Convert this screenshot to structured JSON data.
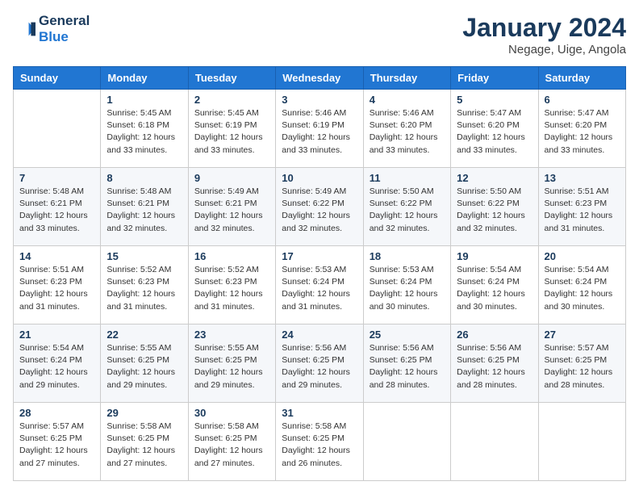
{
  "logo": {
    "line1": "General",
    "line2": "Blue"
  },
  "title": "January 2024",
  "subtitle": "Negage, Uige, Angola",
  "weekdays": [
    "Sunday",
    "Monday",
    "Tuesday",
    "Wednesday",
    "Thursday",
    "Friday",
    "Saturday"
  ],
  "weeks": [
    [
      {
        "day": "",
        "info": ""
      },
      {
        "day": "1",
        "info": "Sunrise: 5:45 AM\nSunset: 6:18 PM\nDaylight: 12 hours\nand 33 minutes."
      },
      {
        "day": "2",
        "info": "Sunrise: 5:45 AM\nSunset: 6:19 PM\nDaylight: 12 hours\nand 33 minutes."
      },
      {
        "day": "3",
        "info": "Sunrise: 5:46 AM\nSunset: 6:19 PM\nDaylight: 12 hours\nand 33 minutes."
      },
      {
        "day": "4",
        "info": "Sunrise: 5:46 AM\nSunset: 6:20 PM\nDaylight: 12 hours\nand 33 minutes."
      },
      {
        "day": "5",
        "info": "Sunrise: 5:47 AM\nSunset: 6:20 PM\nDaylight: 12 hours\nand 33 minutes."
      },
      {
        "day": "6",
        "info": "Sunrise: 5:47 AM\nSunset: 6:20 PM\nDaylight: 12 hours\nand 33 minutes."
      }
    ],
    [
      {
        "day": "7",
        "info": "Sunrise: 5:48 AM\nSunset: 6:21 PM\nDaylight: 12 hours\nand 33 minutes."
      },
      {
        "day": "8",
        "info": "Sunrise: 5:48 AM\nSunset: 6:21 PM\nDaylight: 12 hours\nand 32 minutes."
      },
      {
        "day": "9",
        "info": "Sunrise: 5:49 AM\nSunset: 6:21 PM\nDaylight: 12 hours\nand 32 minutes."
      },
      {
        "day": "10",
        "info": "Sunrise: 5:49 AM\nSunset: 6:22 PM\nDaylight: 12 hours\nand 32 minutes."
      },
      {
        "day": "11",
        "info": "Sunrise: 5:50 AM\nSunset: 6:22 PM\nDaylight: 12 hours\nand 32 minutes."
      },
      {
        "day": "12",
        "info": "Sunrise: 5:50 AM\nSunset: 6:22 PM\nDaylight: 12 hours\nand 32 minutes."
      },
      {
        "day": "13",
        "info": "Sunrise: 5:51 AM\nSunset: 6:23 PM\nDaylight: 12 hours\nand 31 minutes."
      }
    ],
    [
      {
        "day": "14",
        "info": "Sunrise: 5:51 AM\nSunset: 6:23 PM\nDaylight: 12 hours\nand 31 minutes."
      },
      {
        "day": "15",
        "info": "Sunrise: 5:52 AM\nSunset: 6:23 PM\nDaylight: 12 hours\nand 31 minutes."
      },
      {
        "day": "16",
        "info": "Sunrise: 5:52 AM\nSunset: 6:23 PM\nDaylight: 12 hours\nand 31 minutes."
      },
      {
        "day": "17",
        "info": "Sunrise: 5:53 AM\nSunset: 6:24 PM\nDaylight: 12 hours\nand 31 minutes."
      },
      {
        "day": "18",
        "info": "Sunrise: 5:53 AM\nSunset: 6:24 PM\nDaylight: 12 hours\nand 30 minutes."
      },
      {
        "day": "19",
        "info": "Sunrise: 5:54 AM\nSunset: 6:24 PM\nDaylight: 12 hours\nand 30 minutes."
      },
      {
        "day": "20",
        "info": "Sunrise: 5:54 AM\nSunset: 6:24 PM\nDaylight: 12 hours\nand 30 minutes."
      }
    ],
    [
      {
        "day": "21",
        "info": "Sunrise: 5:54 AM\nSunset: 6:24 PM\nDaylight: 12 hours\nand 29 minutes."
      },
      {
        "day": "22",
        "info": "Sunrise: 5:55 AM\nSunset: 6:25 PM\nDaylight: 12 hours\nand 29 minutes."
      },
      {
        "day": "23",
        "info": "Sunrise: 5:55 AM\nSunset: 6:25 PM\nDaylight: 12 hours\nand 29 minutes."
      },
      {
        "day": "24",
        "info": "Sunrise: 5:56 AM\nSunset: 6:25 PM\nDaylight: 12 hours\nand 29 minutes."
      },
      {
        "day": "25",
        "info": "Sunrise: 5:56 AM\nSunset: 6:25 PM\nDaylight: 12 hours\nand 28 minutes."
      },
      {
        "day": "26",
        "info": "Sunrise: 5:56 AM\nSunset: 6:25 PM\nDaylight: 12 hours\nand 28 minutes."
      },
      {
        "day": "27",
        "info": "Sunrise: 5:57 AM\nSunset: 6:25 PM\nDaylight: 12 hours\nand 28 minutes."
      }
    ],
    [
      {
        "day": "28",
        "info": "Sunrise: 5:57 AM\nSunset: 6:25 PM\nDaylight: 12 hours\nand 27 minutes."
      },
      {
        "day": "29",
        "info": "Sunrise: 5:58 AM\nSunset: 6:25 PM\nDaylight: 12 hours\nand 27 minutes."
      },
      {
        "day": "30",
        "info": "Sunrise: 5:58 AM\nSunset: 6:25 PM\nDaylight: 12 hours\nand 27 minutes."
      },
      {
        "day": "31",
        "info": "Sunrise: 5:58 AM\nSunset: 6:25 PM\nDaylight: 12 hours\nand 26 minutes."
      },
      {
        "day": "",
        "info": ""
      },
      {
        "day": "",
        "info": ""
      },
      {
        "day": "",
        "info": ""
      }
    ]
  ]
}
